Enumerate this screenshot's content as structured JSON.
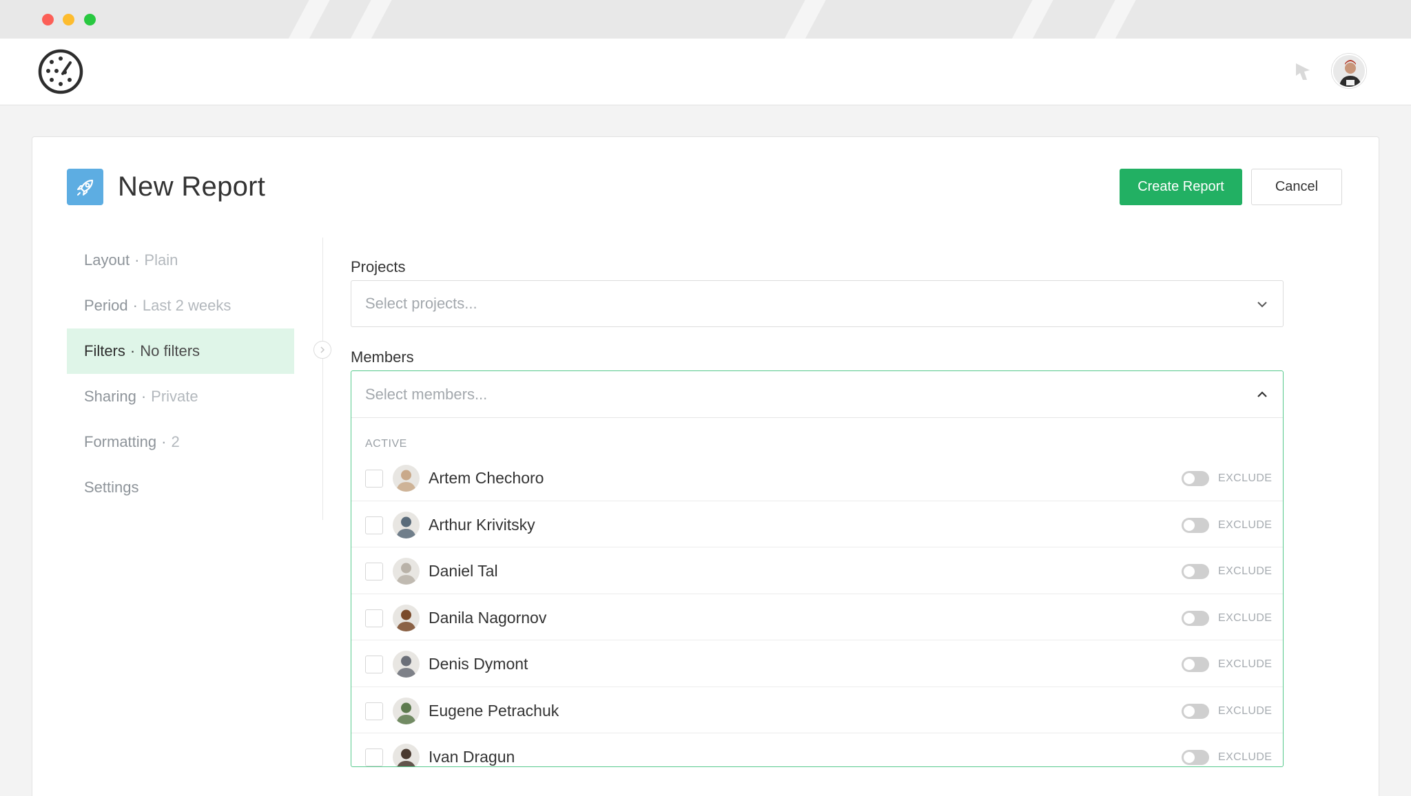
{
  "header": {
    "logo_icon": "stopwatch-logo-icon",
    "notification_icon": "bell-icon",
    "user_avatar": "user-avatar"
  },
  "page": {
    "title": "New Report",
    "icon": "rocket-icon",
    "create_label": "Create Report",
    "cancel_label": "Cancel"
  },
  "steps": [
    {
      "key": "Layout",
      "value": "Plain",
      "active": false
    },
    {
      "key": "Period",
      "value": "Last 2 weeks",
      "active": false
    },
    {
      "key": "Filters",
      "value": "No filters",
      "active": true
    },
    {
      "key": "Sharing",
      "value": "Private",
      "active": false
    },
    {
      "key": "Formatting",
      "value": "2",
      "active": false
    },
    {
      "key": "Settings",
      "value": "",
      "active": false
    }
  ],
  "projects": {
    "label": "Projects",
    "placeholder": "Select projects..."
  },
  "members": {
    "label": "Members",
    "placeholder": "Select members...",
    "group_label": "ACTIVE",
    "exclude_label": "EXCLUDE",
    "list": [
      {
        "name": "Artem Chechoro",
        "avatar_color": "#c9a98a"
      },
      {
        "name": "Arthur Krivitsky",
        "avatar_color": "#5a6b7a"
      },
      {
        "name": "Daniel Tal",
        "avatar_color": "#b9b2a8"
      },
      {
        "name": "Danila Nagornov",
        "avatar_color": "#7a4a2a"
      },
      {
        "name": "Denis Dymont",
        "avatar_color": "#6b6f78"
      },
      {
        "name": "Eugene Petrachuk",
        "avatar_color": "#5d7a4e"
      },
      {
        "name": "Ivan Dragun",
        "avatar_color": "#4a3a30"
      }
    ]
  },
  "colors": {
    "primary": "#22b063",
    "active_step_bg": "#dff5e8",
    "focus_border": "#56c98c",
    "report_icon_bg": "#5dade2"
  }
}
